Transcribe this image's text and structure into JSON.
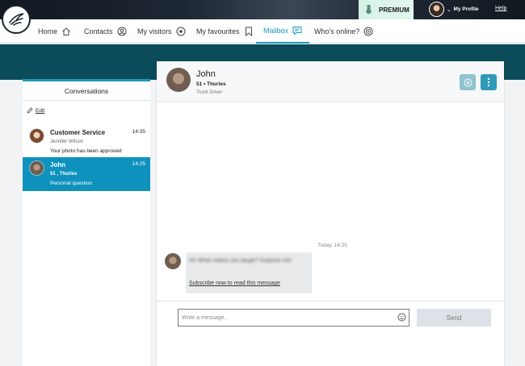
{
  "topbar": {
    "premium_label": "PREMIUM",
    "profile_label": "My Profile",
    "profile_chevron": "⌄",
    "help_label": "Help"
  },
  "nav": {
    "items": [
      {
        "label": "Home",
        "icon": "home-icon"
      },
      {
        "label": "Contacts",
        "icon": "contacts-icon"
      },
      {
        "label": "My visitors",
        "icon": "eye-icon"
      },
      {
        "label": "My favourites",
        "icon": "bookmark-icon"
      },
      {
        "label": "Mailbox",
        "icon": "chat-icon",
        "active": true
      },
      {
        "label": "Who's online?",
        "icon": "online-icon"
      }
    ]
  },
  "sidebar": {
    "tab_label": "Conversations",
    "edit_label": "Edit",
    "conversations": [
      {
        "name": "Customer Service",
        "time": "14:35",
        "sub": "Jennifer Wilson",
        "message": "Your photo has been approved"
      },
      {
        "name": "John",
        "time": "14:25",
        "sub": "51 , Thurles",
        "message": "Personal question",
        "selected": true
      }
    ]
  },
  "chat": {
    "name": "John",
    "info": "51 • Thurles",
    "job": "Truck Driver",
    "date_label": "Today, 14:25",
    "blurred_message": "Hi! What makes you laugh? Surprise me!",
    "subscribe_label": "Subscribe now to read this message",
    "input_placeholder": "Write a message...",
    "send_label": "Send"
  },
  "colors": {
    "accent": "#1898b8",
    "selected_bg": "#0e92bd",
    "band": "#0c4c5a"
  }
}
